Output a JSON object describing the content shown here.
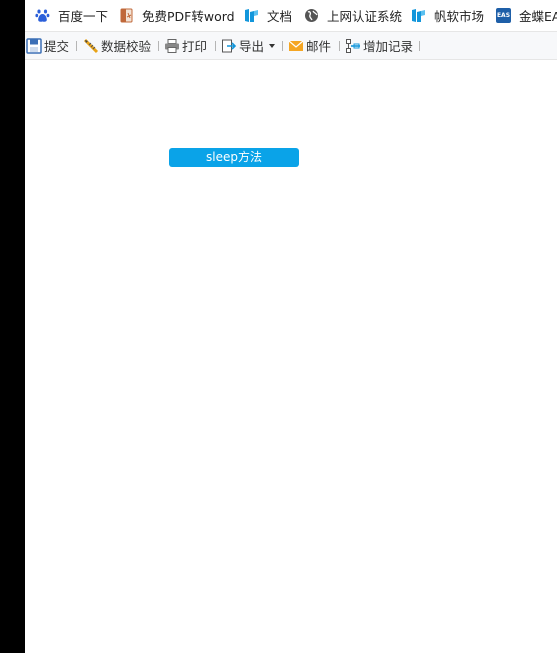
{
  "bookmarks": [
    {
      "label": "百度一下",
      "icon": "baidu-paw-icon"
    },
    {
      "label": "免费PDF转word",
      "icon": "pdf-icon"
    },
    {
      "label": "文档",
      "icon": "fanruan-logo-icon"
    },
    {
      "label": "上网认证系统",
      "icon": "globe-icon"
    },
    {
      "label": "帆软市场",
      "icon": "fanruan-logo-icon"
    },
    {
      "label": "金蝶EAS",
      "icon": "eas-logo-icon",
      "icon_text": "EAS"
    }
  ],
  "toolbar": {
    "submit_label": "提交",
    "validate_label": "数据校验",
    "print_label": "打印",
    "export_label": "导出",
    "mail_label": "邮件",
    "add_record_label": "增加记录"
  },
  "main": {
    "sleep_button_label": "sleep方法"
  },
  "colors": {
    "primary_button": "#0aa3e8",
    "toolbar_bg": "#f7f8fa",
    "baidu_blue": "#2b5fd9",
    "fanruan_blue": "#1296db",
    "mail_orange": "#f5a623"
  }
}
